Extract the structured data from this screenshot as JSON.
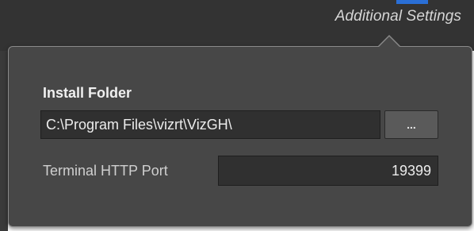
{
  "header": {
    "settings_link": "Additional Settings"
  },
  "popup": {
    "install_folder": {
      "label": "Install Folder",
      "value": "C:\\Program Files\\vizrt\\VizGH\\",
      "browse_label": "..."
    },
    "terminal_port": {
      "label": "Terminal HTTP Port",
      "value": "19399"
    }
  },
  "colors": {
    "panel_background": "#474747",
    "input_background": "#303030",
    "accent_fragment": "#2a6fd6"
  }
}
